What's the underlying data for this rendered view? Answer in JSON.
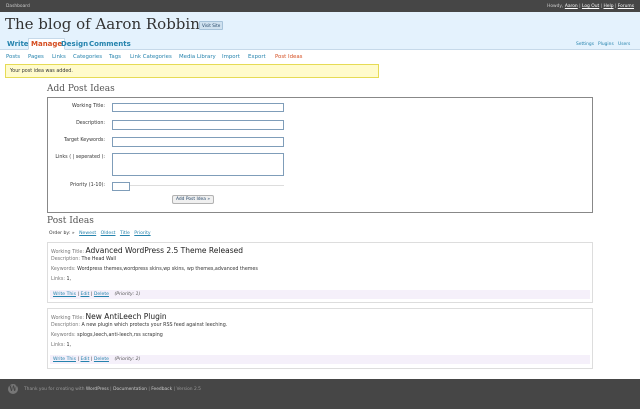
{
  "topbar": {
    "dashboard": "Dashboard",
    "howdy": "Howdy,",
    "user": "Aaron",
    "logout": "Log Out",
    "help": "Help",
    "forums": "Forums"
  },
  "header": {
    "title": "The blog of Aaron Robbins",
    "visit_site": "Visit Site"
  },
  "menu": {
    "items": [
      "Write",
      "Manage",
      "Design",
      "Comments"
    ],
    "right": [
      "Settings",
      "Plugins",
      "Users"
    ]
  },
  "submenu": [
    "Posts",
    "Pages",
    "Links",
    "Categories",
    "Tags",
    "Link Categories",
    "Media Library",
    "Import",
    "Export",
    "Post Ideas"
  ],
  "notice": "Your post idea was added.",
  "form": {
    "heading": "Add Post Ideas",
    "working_title_label": "Working Title:",
    "description_label": "Description:",
    "keywords_label": "Target Keywords:",
    "links_label": "Links ( | seperated ):",
    "priority_label": "Priority (1-10):",
    "submit": "Add Post Idea »"
  },
  "list": {
    "heading": "Post Ideas",
    "order_by": "Order by: »",
    "order_options": [
      "Newest",
      "Oldest",
      "Title",
      "Priority"
    ],
    "labels": {
      "working_title": "Working Title:",
      "description": "Description:",
      "keywords": "Keywords:",
      "links": "Links:"
    },
    "actions": {
      "write": "Write This",
      "edit": "Edit",
      "delete": "Delete",
      "sep": "|"
    },
    "items": [
      {
        "title": "Advanced WordPress 2.5 Theme Released",
        "description": "The Head Wall",
        "keywords": "Wordpress themes,wordpress skins,wp skins, wp themes,advanced themes",
        "links": "1,",
        "priority": "(Priority: 1)"
      },
      {
        "title": "New AntiLeech Plugin",
        "description": "A new plugin which protects your RSS feed against leeching.",
        "keywords": "splogs,leech,anti-leech,rss scraping",
        "links": "1,",
        "priority": "(Priority: 2)"
      }
    ]
  },
  "footer": {
    "logo": "W",
    "thanks": "Thank you for creating with",
    "wordpress": "WordPress",
    "documentation": "Documentation",
    "feedback": "Feedback",
    "version": "Version 2.5",
    "sep": "|"
  },
  "colors": {
    "accent": "#2583ad",
    "active": "#d54e21",
    "header_bg": "#e4f2fd",
    "bar_bg": "#464646",
    "notice_bg": "#fffbcc"
  }
}
